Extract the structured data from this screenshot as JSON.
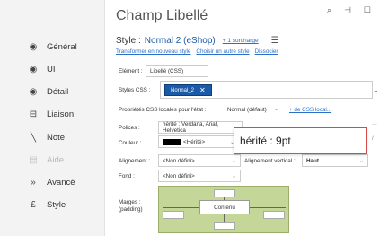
{
  "window": {
    "title": "Champ Libellé",
    "icons": [
      "search-icon",
      "pin-icon",
      "restore-icon"
    ]
  },
  "sidebar": {
    "items": [
      {
        "label": "Général",
        "icon": "◉",
        "disabled": false
      },
      {
        "label": "UI",
        "icon": "◉",
        "disabled": false
      },
      {
        "label": "Détail",
        "icon": "◉",
        "disabled": false
      },
      {
        "label": "Liaison",
        "icon": "⊟",
        "disabled": false
      },
      {
        "label": "Note",
        "icon": "╲",
        "disabled": false
      },
      {
        "label": "Aide",
        "icon": "▤",
        "disabled": true
      },
      {
        "label": "Avancé",
        "icon": "»",
        "disabled": false
      },
      {
        "label": "Style",
        "icon": "£",
        "disabled": false
      }
    ]
  },
  "style": {
    "label": "Style :",
    "value": "Normal 2 (eShop)",
    "surcharge": "+ 1 surcharge",
    "links": [
      "Transformer en nouveau style",
      "Choisir un autre style",
      "Dissocier"
    ]
  },
  "form": {
    "element_label": "Elément :",
    "element_value": "Libellé (CSS)",
    "styles_css_label": "Styles CSS :",
    "styles_css_tag": "Normal_2",
    "proprietes_label": "Propriétés CSS locales pour l'état :",
    "proprietes_value": "Normal (défaut)",
    "proprietes_link": "+ de CSS local...",
    "polices_label": "Polices :",
    "polices_value": "hérité : Verdana, Arial, Helvetica",
    "couleur_label": "Couleur :",
    "couleur_value": "<Hérité>",
    "alignement_label": "Alignement :",
    "alignement_value": "<Non défini>",
    "alignement_vertical_label": "Alignement vertical :",
    "alignement_vertical_value": "Haut",
    "fond_label": "Fond :",
    "fond_value": "<Non défini>",
    "marges_label": "Marges :",
    "marges_sub": "(padding)",
    "contenu_label": "Contenu"
  },
  "tooltip": {
    "text": "hérité : 9pt"
  },
  "colors": {
    "accent": "#1a5aa6",
    "tooltip_border": "#d84a4a",
    "padding_bg": "#c5d699"
  }
}
